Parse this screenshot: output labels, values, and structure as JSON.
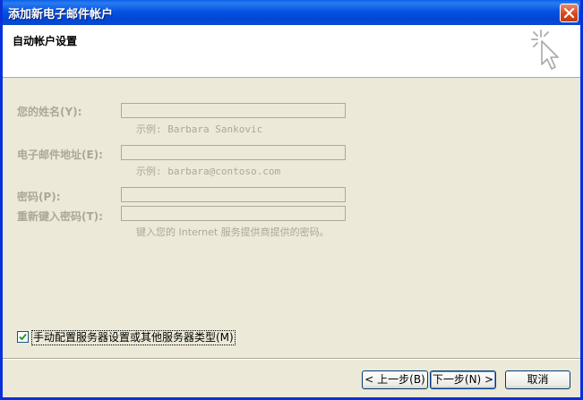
{
  "window": {
    "title": "添加新电子邮件帐户"
  },
  "header": {
    "title": "自动帐户设置"
  },
  "fields": [
    {
      "label": "您的姓名(Y):",
      "value": "",
      "hint": "示例: Barbara Sankovic"
    },
    {
      "label": "电子邮件地址(E):",
      "value": "",
      "hint": "示例: barbara@contoso.com"
    },
    {
      "label": "密码(P):",
      "value": ""
    },
    {
      "label": "重新键入密码(T):",
      "value": "",
      "hint": "键入您的 Internet 服务提供商提供的密码。"
    }
  ],
  "manual_config": {
    "label": "手动配置服务器设置或其他服务器类型(M)",
    "checked": true
  },
  "buttons": {
    "back": "< 上一步(B)",
    "next": "下一步(N) >",
    "cancel": "取消"
  },
  "colors": {
    "title_bar": "#0054e3",
    "disabled_text": "#aca899",
    "dialog_bg": "#ece9d8"
  },
  "icons": {
    "close": "close-icon",
    "header": "wizard-cursor-icon",
    "check": "check-icon"
  }
}
